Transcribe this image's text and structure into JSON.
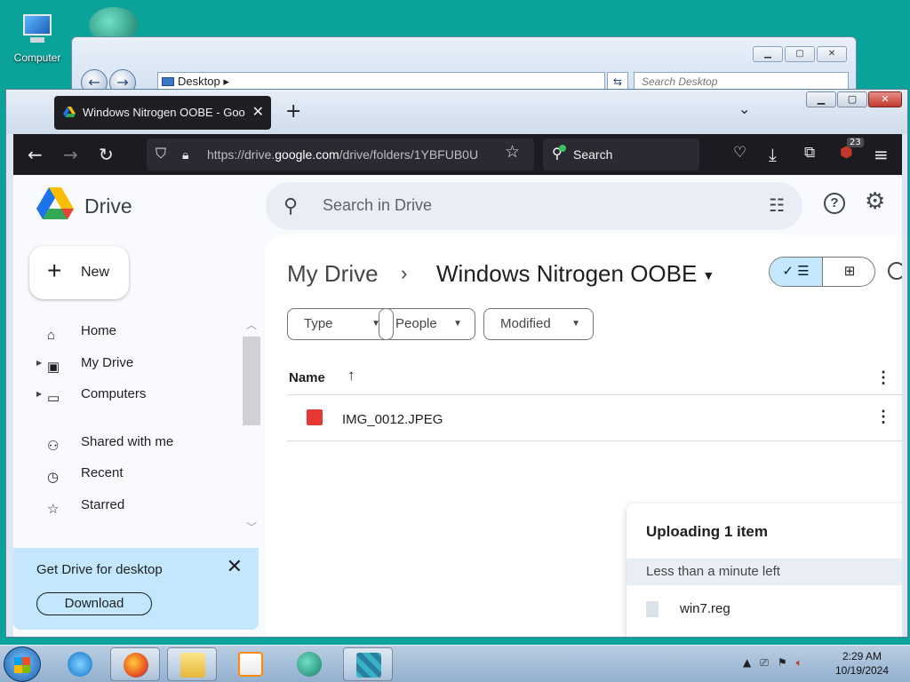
{
  "desktop": {
    "computer_label": "Computer"
  },
  "explorer": {
    "address": "Desktop",
    "search_placeholder": "Search Desktop"
  },
  "browser": {
    "tab_title": "Windows Nitrogen OOBE - Goo",
    "url_prefix": "https://drive.",
    "url_host": "google.com",
    "url_rest": "/drive/folders/1YBFUB0U",
    "search_label": "Search",
    "ublock_count": "23"
  },
  "drive": {
    "brand": "Drive",
    "search_placeholder": "Search in Drive",
    "new_label": "New",
    "nav": [
      {
        "label": "Home"
      },
      {
        "label": "My Drive"
      },
      {
        "label": "Computers"
      },
      {
        "label": "Shared with me"
      },
      {
        "label": "Recent"
      },
      {
        "label": "Starred"
      }
    ],
    "promo": {
      "title": "Get Drive for desktop",
      "button": "Download"
    },
    "breadcrumb": {
      "root": "My Drive",
      "current": "Windows Nitrogen OOBE"
    },
    "filters": [
      "Type",
      "People",
      "Modified"
    ],
    "column_name": "Name",
    "files": [
      {
        "name": "IMG_0012.JPEG"
      }
    ],
    "upload": {
      "title": "Uploading 1 item",
      "status": "Less than a minute left",
      "file": "win7.reg"
    }
  },
  "taskbar": {
    "time": "2:29 AM",
    "date": "10/19/2024"
  },
  "colors": {
    "drive_blue": "#1a73e8",
    "accent_light": "#c2e7ff",
    "firefox_dark": "#1c1b22",
    "desktop_teal": "#0aa39a"
  }
}
